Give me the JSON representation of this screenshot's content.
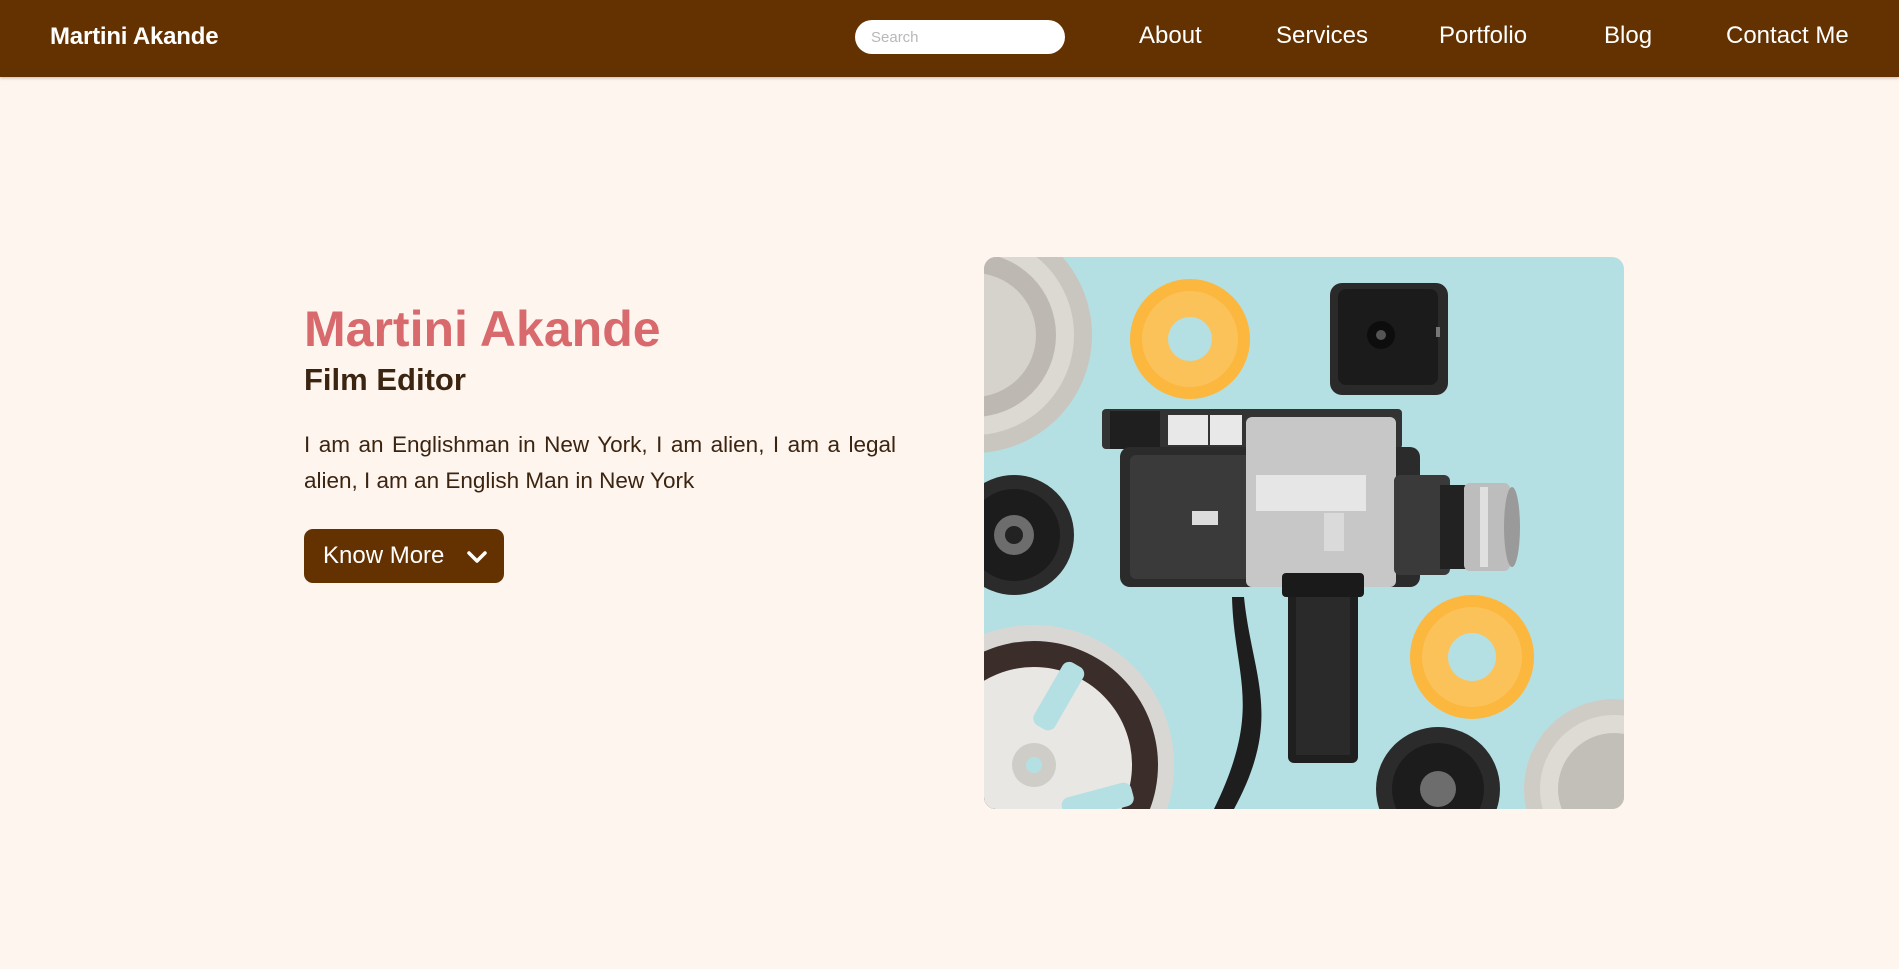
{
  "header": {
    "brand": "Martini Akande",
    "search": {
      "placeholder": "Search",
      "value": ""
    },
    "nav": [
      {
        "label": "About"
      },
      {
        "label": "Services"
      },
      {
        "label": "Portfolio"
      },
      {
        "label": "Blog"
      },
      {
        "label": "Contact Me"
      }
    ]
  },
  "hero": {
    "name": "Martini Akande",
    "role": "Film Editor",
    "description": "I am an Englishman in New York, I am alien, I am a legal alien, I am an English Man in New York",
    "cta": {
      "label": "Know More",
      "icon": "chevron-down-icon"
    },
    "image": {
      "subject": "vintage-film-camera-with-film-reels"
    }
  },
  "colors": {
    "header_bg": "#643200",
    "page_bg": "#fff5ef",
    "accent_name": "#d86a6e",
    "body_text": "#3b2410",
    "button_bg": "#643200",
    "photo_bg": "#b4e0e3",
    "reel_yellow": "#fbb73e"
  }
}
